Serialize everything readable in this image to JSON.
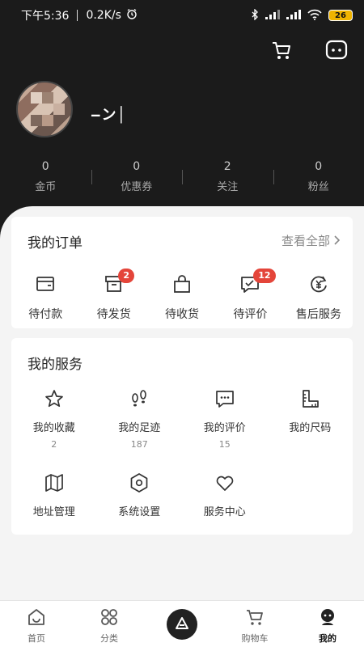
{
  "status_bar": {
    "time": "下午5:36",
    "network_speed": "0.2K/s",
    "battery": "26"
  },
  "profile": {
    "username": "‒ン│"
  },
  "stats": [
    {
      "value": "0",
      "label": "金币"
    },
    {
      "value": "0",
      "label": "优惠券"
    },
    {
      "value": "2",
      "label": "关注"
    },
    {
      "value": "0",
      "label": "粉丝"
    }
  ],
  "orders": {
    "title": "我的订单",
    "view_all": "查看全部",
    "items": [
      {
        "label": "待付款",
        "icon": "wallet-icon",
        "badge": ""
      },
      {
        "label": "待发货",
        "icon": "box-icon",
        "badge": "2"
      },
      {
        "label": "待收货",
        "icon": "bag-icon",
        "badge": ""
      },
      {
        "label": "待评价",
        "icon": "comment-icon",
        "badge": "12"
      },
      {
        "label": "售后服务",
        "icon": "refund-icon",
        "badge": ""
      }
    ]
  },
  "services": {
    "title": "我的服务",
    "items": [
      {
        "label": "我的收藏",
        "count": "2",
        "icon": "star-icon"
      },
      {
        "label": "我的足迹",
        "count": "187",
        "icon": "footprints-icon"
      },
      {
        "label": "我的评价",
        "count": "15",
        "icon": "chat-dots-icon"
      },
      {
        "label": "我的尺码",
        "count": "",
        "icon": "ruler-icon"
      },
      {
        "label": "地址管理",
        "count": "",
        "icon": "map-icon"
      },
      {
        "label": "系统设置",
        "count": "",
        "icon": "settings-hex-icon"
      },
      {
        "label": "服务中心",
        "count": "",
        "icon": "heart-icon"
      }
    ]
  },
  "tabbar": [
    {
      "label": "首页",
      "icon": "home-icon"
    },
    {
      "label": "分类",
      "icon": "grid-icon"
    },
    {
      "label": "",
      "icon": "brand-center-icon"
    },
    {
      "label": "购物车",
      "icon": "cart-icon"
    },
    {
      "label": "我的",
      "icon": "profile-icon"
    }
  ],
  "colors": {
    "header_bg": "#1b1b1b",
    "badge": "#e4453a",
    "battery": "#f0b400"
  }
}
